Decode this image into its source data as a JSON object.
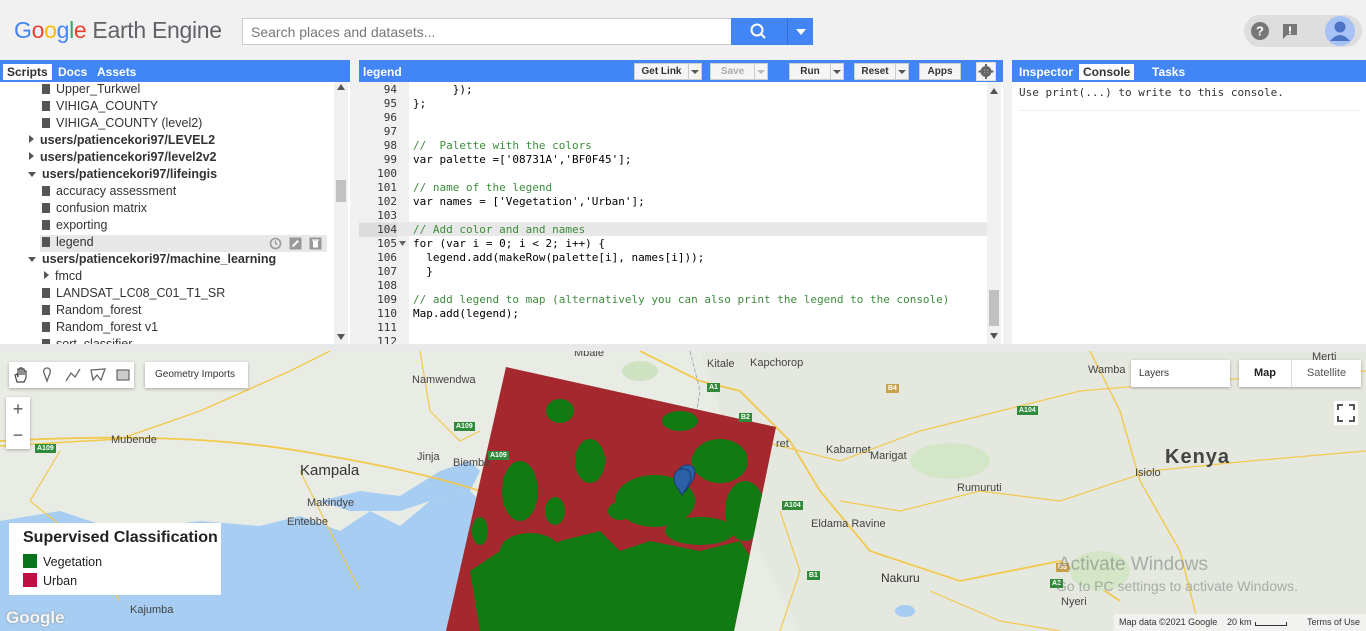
{
  "header": {
    "logo_google": [
      "G",
      "o",
      "o",
      "g",
      "l",
      "e"
    ],
    "logo_product": "Earth Engine",
    "search_placeholder": "Search places and datasets..."
  },
  "left_panel": {
    "tabs": [
      {
        "label": "Scripts",
        "active": true
      },
      {
        "label": "Docs",
        "active": false
      },
      {
        "label": "Assets",
        "active": false
      }
    ],
    "tree": [
      {
        "label": "Upper_Turkwel",
        "kind": "file",
        "depth": 2
      },
      {
        "label": "VIHIGA_COUNTY",
        "kind": "file",
        "depth": 2
      },
      {
        "label": "VIHIGA_COUNTY (level2)",
        "kind": "file",
        "depth": 2
      },
      {
        "label": "users/patiencekori97/LEVEL2",
        "kind": "folder-closed",
        "depth": 1
      },
      {
        "label": "users/patiencekori97/level2v2",
        "kind": "folder-closed",
        "depth": 1
      },
      {
        "label": "users/patiencekori97/lifeingis",
        "kind": "folder-open",
        "depth": 1
      },
      {
        "label": "accuracy assessment",
        "kind": "file",
        "depth": 2
      },
      {
        "label": "confusion matrix",
        "kind": "file",
        "depth": 2
      },
      {
        "label": "exporting",
        "kind": "file",
        "depth": 2
      },
      {
        "label": "legend",
        "kind": "file",
        "depth": 2,
        "selected": true
      },
      {
        "label": "users/patiencekori97/machine_learning",
        "kind": "folder-open",
        "depth": 1
      },
      {
        "label": "fmcd",
        "kind": "subfolder-closed",
        "depth": 2
      },
      {
        "label": "LANDSAT_LC08_C01_T1_SR",
        "kind": "file",
        "depth": 2
      },
      {
        "label": "Random_forest",
        "kind": "file",
        "depth": 2
      },
      {
        "label": "Random_forest v1",
        "kind": "file",
        "depth": 2
      },
      {
        "label": "sort_classifier",
        "kind": "file",
        "depth": 2
      }
    ]
  },
  "editor": {
    "script_name": "legend",
    "buttons": {
      "get_link": "Get Link",
      "save": "Save",
      "run": "Run",
      "reset": "Reset",
      "apps": "Apps"
    },
    "current_line": 104,
    "lines": [
      {
        "n": "94",
        "text": "      });"
      },
      {
        "n": "95",
        "text": "};"
      },
      {
        "n": "96",
        "text": ""
      },
      {
        "n": "97",
        "text": ""
      },
      {
        "n": "98",
        "text": "//  Palette with the colors",
        "type": "comment"
      },
      {
        "n": "99",
        "text": "var palette =['08731A','BF0F45'];"
      },
      {
        "n": "100",
        "text": ""
      },
      {
        "n": "101",
        "text": "// name of the legend",
        "type": "comment"
      },
      {
        "n": "102",
        "text": "var names = ['Vegetation','Urban'];"
      },
      {
        "n": "103",
        "text": ""
      },
      {
        "n": "104",
        "text": "// Add color and and names",
        "type": "comment"
      },
      {
        "n": "105",
        "text": "for (var i = 0; i < 2; i++) {"
      },
      {
        "n": "106",
        "text": "  legend.add(makeRow(palette[i], names[i]));"
      },
      {
        "n": "107",
        "text": "  }"
      },
      {
        "n": "108",
        "text": ""
      },
      {
        "n": "109",
        "text": "// add legend to map (alternatively you can also print the legend to the console)",
        "type": "comment"
      },
      {
        "n": "110",
        "text": "Map.add(legend);"
      },
      {
        "n": "111",
        "text": ""
      },
      {
        "n": "112",
        "text": ""
      }
    ]
  },
  "right_panel": {
    "tabs": [
      {
        "label": "Inspector",
        "active": false
      },
      {
        "label": "Console",
        "active": true
      },
      {
        "label": "Tasks",
        "active": false
      }
    ],
    "console_message": "Use print(...) to write to this console."
  },
  "map": {
    "geometry_imports": "Geometry Imports",
    "zoom_in": "+",
    "zoom_out": "−",
    "layers_label": "Layers",
    "map_type_map": "Map",
    "map_type_satellite": "Satellite",
    "legend": {
      "title": "Supervised Classification",
      "items": [
        {
          "label": "Vegetation",
          "color": "#08731A"
        },
        {
          "label": "Urban",
          "color": "#BF0F45"
        }
      ]
    },
    "places": {
      "mbale": "Mbale",
      "kapchorop": "Kapchorop",
      "merti": "Merti",
      "namwendwa": "Namwendwa",
      "wamba": "Wamba",
      "kitale": "Kitale",
      "kampala": "Kampala",
      "jinja": "Jinja",
      "biembe": "Biembe",
      "mubende": "Mubende",
      "makindye": "Makindye",
      "entebbe": "Entebbe",
      "kabarnet": "Kabarnet",
      "marigat": "Marigat",
      "isiolo": "Isiolo",
      "kenya": "Kenya",
      "rumuruti": "Rumuruti",
      "eldama_ravine": "Eldama Ravine",
      "nakuru": "Nakuru",
      "kajumba": "Kajumba",
      "nyeri": "Nyeri",
      "ret": "ret"
    },
    "roads": [
      "A109",
      "A109",
      "A104",
      "A1",
      "B4",
      "B2",
      "B5",
      "A2",
      "B1",
      "A104",
      "A109"
    ],
    "watermark_1": "Activate Windows",
    "watermark_2": "Go to PC settings to activate Windows.",
    "google_mark": "Google",
    "map_data": "Map data ©2021 Google",
    "scale": "20 km",
    "terms": "Terms of Use"
  }
}
